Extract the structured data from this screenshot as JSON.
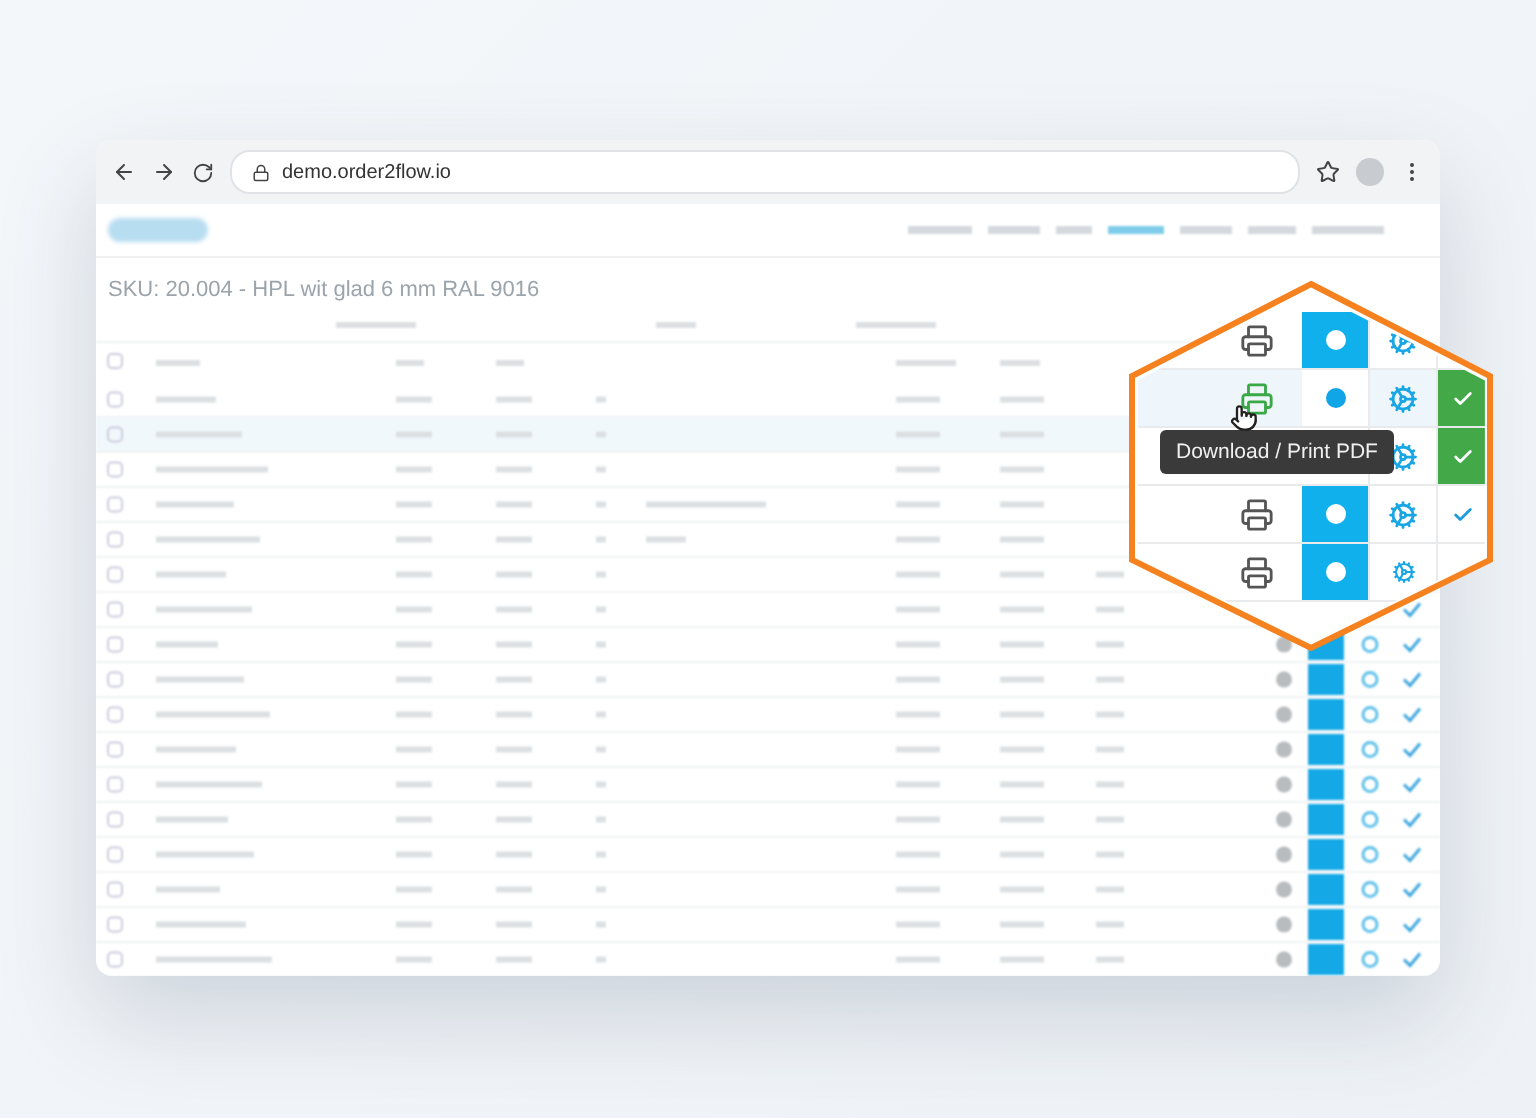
{
  "browser": {
    "url": "demo.order2flow.io"
  },
  "page": {
    "title": "SKU: 20.004 - HPL wit glad 6 mm RAL 9016"
  },
  "zoom": {
    "tooltip": "Download / Print PDF",
    "rows": [
      {
        "covered": false,
        "printer_active": false,
        "settings_filled": true,
        "done_checked": false
      },
      {
        "covered": false,
        "printer_active": true,
        "settings_filled": false,
        "done_checked": true,
        "done_filled": true
      },
      {
        "covered": true,
        "printer_active": false,
        "done_checked": true,
        "done_filled": true
      },
      {
        "covered": false,
        "printer_active": false,
        "settings_filled": true,
        "done_checked": true,
        "done_filled": false
      },
      {
        "covered": false,
        "printer_active": false,
        "settings_filled": true,
        "done_checked": false
      }
    ]
  }
}
